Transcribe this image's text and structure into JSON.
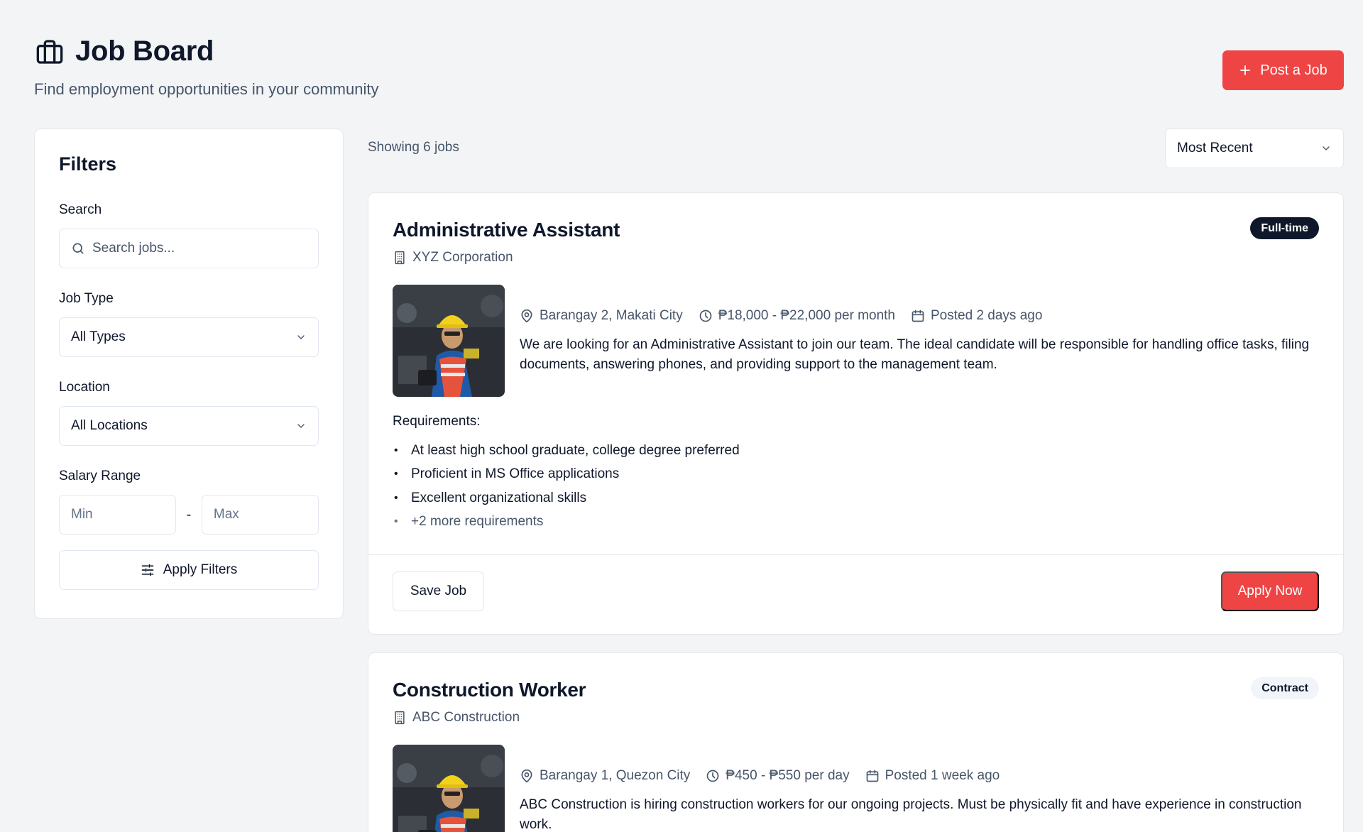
{
  "header": {
    "title": "Job Board",
    "subtitle": "Find employment opportunities in your community",
    "post_button": "Post a Job"
  },
  "filters": {
    "title": "Filters",
    "search_label": "Search",
    "search_placeholder": "Search jobs...",
    "job_type_label": "Job Type",
    "job_type_value": "All Types",
    "location_label": "Location",
    "location_value": "All Locations",
    "salary_label": "Salary Range",
    "salary_min_placeholder": "Min",
    "salary_separator": "-",
    "salary_max_placeholder": "Max",
    "apply_button": "Apply Filters"
  },
  "results": {
    "showing_text": "Showing 6 jobs",
    "sort_value": "Most Recent"
  },
  "jobs": [
    {
      "title": "Administrative Assistant",
      "company": "XYZ Corporation",
      "type": "Full-time",
      "location": "Barangay 2, Makati City",
      "salary": "₱18,000 - ₱22,000 per month",
      "posted": "Posted 2 days ago",
      "description": "We are looking for an Administrative Assistant to join our team. The ideal candidate will be responsible for handling office tasks, filing documents, answering phones, and providing support to the management team.",
      "requirements_label": "Requirements:",
      "requirements": [
        "At least high school graduate, college degree preferred",
        "Proficient in MS Office applications",
        "Excellent organizational skills"
      ],
      "more_requirements": "+2 more requirements",
      "save_button": "Save Job",
      "apply_button": "Apply Now"
    },
    {
      "title": "Construction Worker",
      "company": "ABC Construction",
      "type": "Contract",
      "location": "Barangay 1, Quezon City",
      "salary": "₱450 - ₱550 per day",
      "posted": "Posted 1 week ago",
      "description": "ABC Construction is hiring construction workers for our ongoing projects. Must be physically fit and have experience in construction work."
    }
  ],
  "colors": {
    "accent": "#ef4444",
    "background": "#f3f4f6",
    "text_primary": "#0f172a",
    "text_muted": "#475569"
  },
  "icons": {
    "title": "briefcase-icon",
    "post": "plus-icon",
    "search": "search-icon",
    "dropdown": "chevron-down-icon",
    "apply_filters": "sliders-icon",
    "company": "building-icon",
    "location": "map-pin-icon",
    "salary": "clock-icon",
    "posted": "calendar-icon"
  }
}
